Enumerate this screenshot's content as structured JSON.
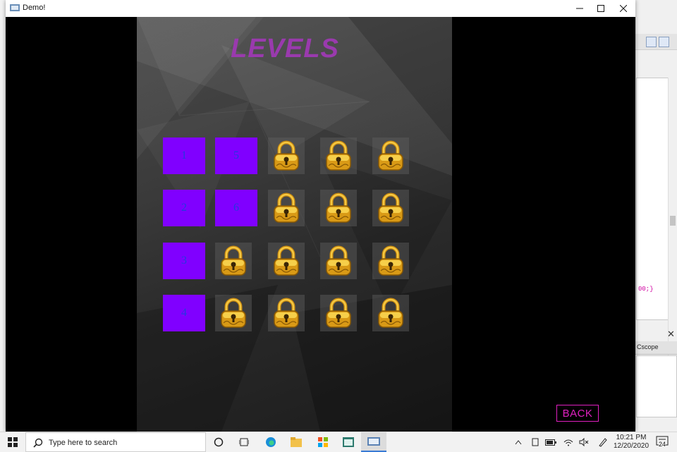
{
  "window": {
    "title": "Demo!"
  },
  "game": {
    "title": "LEVELS",
    "tile_color": "#8000ff",
    "tile_text_color": "#2438e0",
    "unlocked_levels": [
      "1",
      "2",
      "3",
      "4",
      "5",
      "6"
    ],
    "locked_count": 14,
    "back_label": "BACK",
    "accent": "#e020c0"
  },
  "background_app": {
    "tab_label": "Cscope",
    "code_fragment": "00;}"
  },
  "taskbar": {
    "search_placeholder": "Type here to search",
    "time": "10:21 PM",
    "date": "12/20/2020",
    "notification_count": "24"
  }
}
